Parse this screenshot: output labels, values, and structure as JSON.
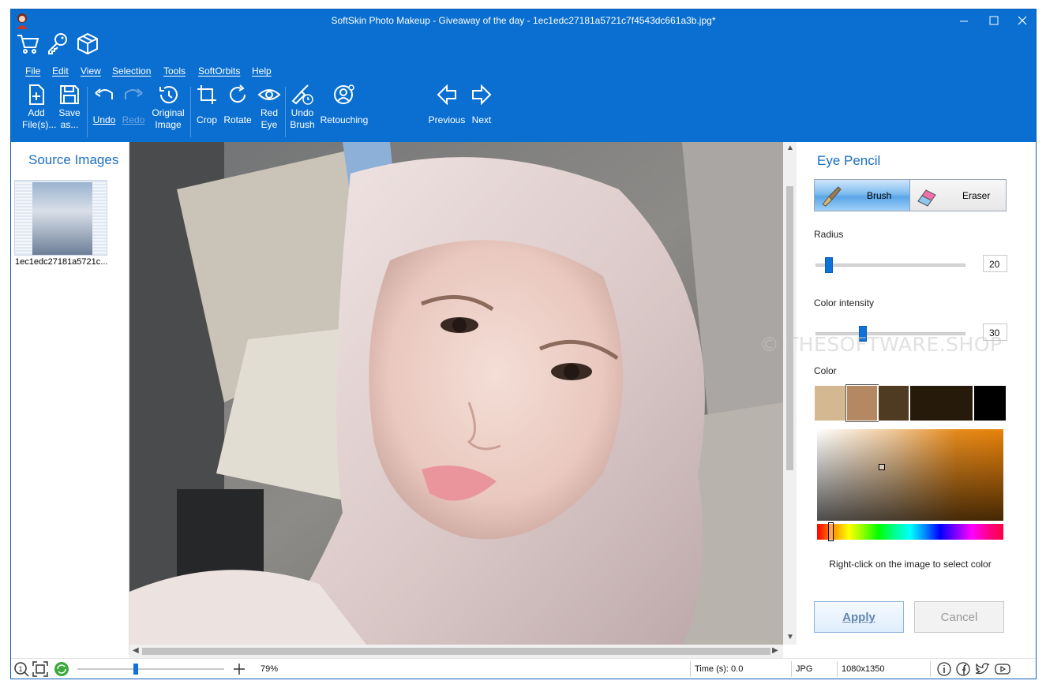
{
  "window": {
    "title": "SoftSkin Photo Makeup - Giveaway of the day - 1ec1edc27181a5721c7f4543dc661a3b.jpg*"
  },
  "quick_access": [
    "cart-icon",
    "key-icon",
    "box-icon"
  ],
  "menu": [
    "File",
    "Edit",
    "View",
    "Selection",
    "Tools",
    "SoftOrbits",
    "Help"
  ],
  "toolbar": {
    "add_files": "Add\nFile(s)...",
    "save_as": "Save\nas...",
    "undo": "Undo",
    "redo": "Redo",
    "original_image": "Original\nImage",
    "crop": "Crop",
    "rotate": "Rotate",
    "red_eye": "Red\nEye",
    "undo_brush": "Undo\nBrush",
    "retouching": "Retouching",
    "previous": "Previous",
    "next": "Next"
  },
  "source_panel": {
    "title": "Source Images",
    "thumbnail_label": "1ec1edc27181a5721c..."
  },
  "tool_panel": {
    "title": "Eye Pencil",
    "brush_label": "Brush",
    "eraser_label": "Eraser",
    "radius_label": "Radius",
    "radius_value": "20",
    "radius_fraction": 0.06,
    "intensity_label": "Color intensity",
    "intensity_value": "30",
    "intensity_fraction": 0.3,
    "color_label": "Color",
    "swatches": [
      "#d4b892",
      "#b48862",
      "#4f3b22",
      "#261a0a",
      "#000000"
    ],
    "hint": "Right-click on the image to select color",
    "apply_label": "Apply",
    "cancel_label": "Cancel"
  },
  "watermark": "© THESOFTWARE.SHOP",
  "status": {
    "zoom": "79%",
    "time": "Time (s): 0.0",
    "format": "JPG",
    "dimensions": "1080x1350"
  },
  "colors": {
    "accent": "#0a6fd0",
    "panel_title": "#1a6fc0",
    "slider": "#0f72d8"
  }
}
